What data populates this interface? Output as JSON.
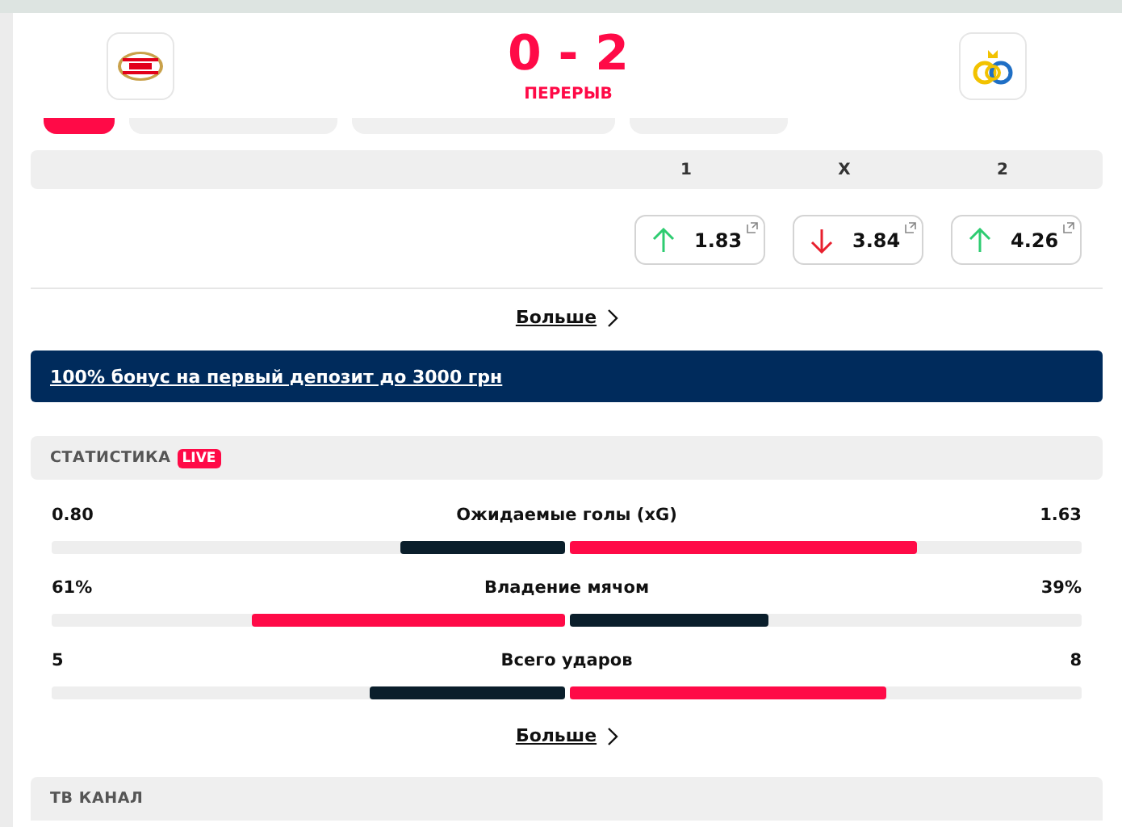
{
  "header": {
    "score": "0 - 2",
    "status": "ПЕРЕРЫВ"
  },
  "tabs": [
    {
      "selected": true
    },
    {
      "selected": false
    },
    {
      "selected": false
    },
    {
      "selected": false
    }
  ],
  "odds": {
    "columns": [
      "1",
      "X",
      "2"
    ],
    "prices": [
      {
        "value": "1.83",
        "kind": "up"
      },
      {
        "value": "3.84",
        "kind": "down"
      },
      {
        "value": "4.26",
        "kind": "up"
      }
    ],
    "more": "Больше"
  },
  "promo": "100% бонус на первый депозит до 3000 грн",
  "statistics": {
    "title": "СТАТИСТИКА",
    "badge": "LIVE",
    "rows": [
      {
        "label": "Ожидаемые голы (xG)",
        "home": "0.80",
        "away": "1.63",
        "home_bar": {
          "level": 0.32
        },
        "away_bar": {
          "level": 0.68
        }
      },
      {
        "label": "Владение мячом",
        "home": "61%",
        "away": "39%",
        "home_bar": {
          "level": 0.61
        },
        "away_bar": {
          "level": 0.39
        }
      },
      {
        "label": "Всего ударов",
        "home": "5",
        "away": "8",
        "home_bar": {
          "level": 0.38
        },
        "away_bar": {
          "level": 0.62
        }
      }
    ],
    "more": "Больше"
  },
  "tv": {
    "title": "ТВ КАНАЛ"
  }
}
